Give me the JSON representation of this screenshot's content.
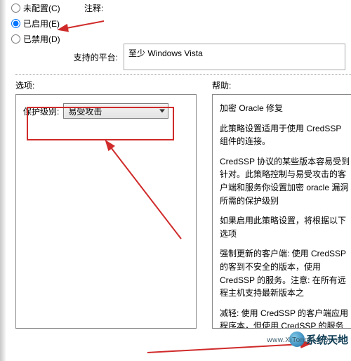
{
  "state": {
    "not_configured": {
      "label": "未配置(C)",
      "checked": false
    },
    "enabled": {
      "label": "已启用(E)",
      "checked": true
    },
    "disabled": {
      "label": "已禁用(D)",
      "checked": false
    }
  },
  "notes_label": "注释:",
  "platform_label": "支持的平台:",
  "platform_value": "至少 Windows Vista",
  "options_label": "选项:",
  "help_label": "帮助:",
  "protection_level_label": "保护级别:",
  "protection_level_value": "易受攻击",
  "help": {
    "p0": "加密 Oracle 修复",
    "p1": "此策略设置适用于使用 CredSSP 组件的连接。",
    "p2": "CredSSP 协议的某些版本容易受到针对。此策略控制与易受攻击的客户端和服务你设置加密 oracle 漏洞所需的保护级别",
    "p3": "如果启用此策略设置，将根据以下选项",
    "p4": "强制更新的客户端: 使用 CredSSP 的客到不安全的版本，使用 CredSSP 的服务。注意: 在所有远程主机支持最新版本之",
    "p5": "减轻: 使用 CredSSP 的客户端应用程序本，但使用 CredSSP 的服务将接受未修补修补客户端所造成的风险的重要信息，"
  },
  "watermark": {
    "brand": "系统天地",
    "url": "www.XiTongTianDi.net"
  }
}
